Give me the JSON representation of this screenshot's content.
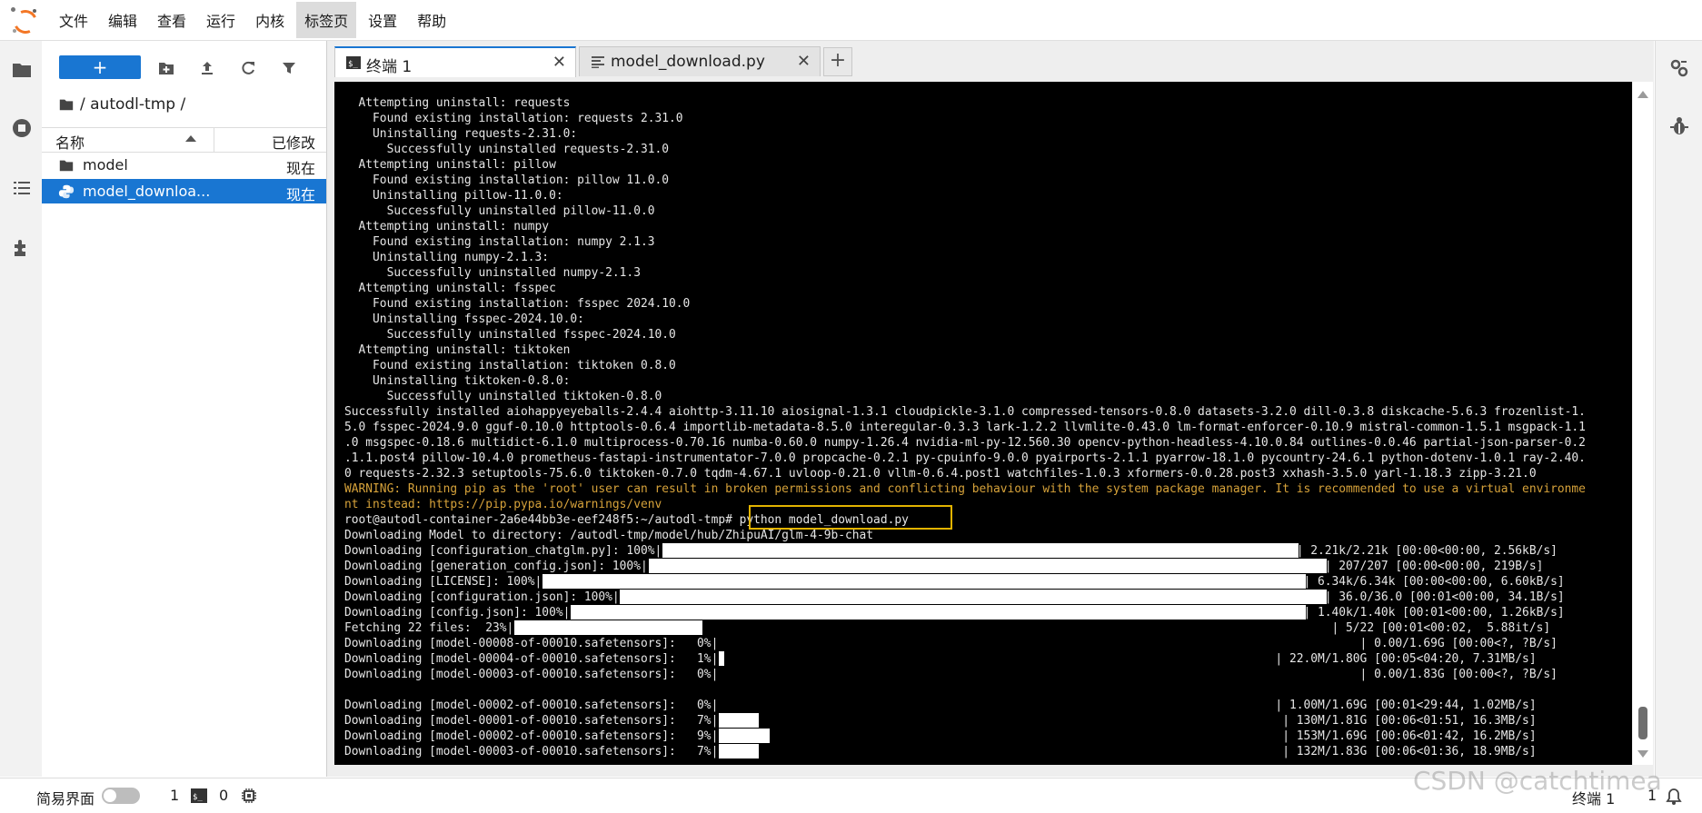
{
  "menu": {
    "items": [
      "文件",
      "编辑",
      "查看",
      "运行",
      "内核",
      "标签页",
      "设置",
      "帮助"
    ],
    "active_index": 5
  },
  "filebrowser": {
    "new_button": "+",
    "breadcrumb": "/ autodl-tmp /",
    "column_name": "名称",
    "column_modified": "已修改",
    "rows": [
      {
        "name": "model",
        "modified": "现在",
        "type": "folder-icon"
      },
      {
        "name": "model_downloa...",
        "modified": "现在",
        "type": "python-file-icon"
      }
    ]
  },
  "tabs": [
    {
      "label": "终端 1",
      "icon": "terminal-icon",
      "close": "✕"
    },
    {
      "label": "model_download.py",
      "icon": "text-file-icon",
      "close": "✕"
    }
  ],
  "tab_add": "+",
  "terminal": {
    "lines": [
      {
        "text": "  Attempting uninstall: requests",
        "warn": false
      },
      {
        "text": "    Found existing installation: requests 2.31.0",
        "warn": false
      },
      {
        "text": "    Uninstalling requests-2.31.0:",
        "warn": false
      },
      {
        "text": "      Successfully uninstalled requests-2.31.0",
        "warn": false
      },
      {
        "text": "  Attempting uninstall: pillow",
        "warn": false
      },
      {
        "text": "    Found existing installation: pillow 11.0.0",
        "warn": false
      },
      {
        "text": "    Uninstalling pillow-11.0.0:",
        "warn": false
      },
      {
        "text": "      Successfully uninstalled pillow-11.0.0",
        "warn": false
      },
      {
        "text": "  Attempting uninstall: numpy",
        "warn": false
      },
      {
        "text": "    Found existing installation: numpy 2.1.3",
        "warn": false
      },
      {
        "text": "    Uninstalling numpy-2.1.3:",
        "warn": false
      },
      {
        "text": "      Successfully uninstalled numpy-2.1.3",
        "warn": false
      },
      {
        "text": "  Attempting uninstall: fsspec",
        "warn": false
      },
      {
        "text": "    Found existing installation: fsspec 2024.10.0",
        "warn": false
      },
      {
        "text": "    Uninstalling fsspec-2024.10.0:",
        "warn": false
      },
      {
        "text": "      Successfully uninstalled fsspec-2024.10.0",
        "warn": false
      },
      {
        "text": "  Attempting uninstall: tiktoken",
        "warn": false
      },
      {
        "text": "    Found existing installation: tiktoken 0.8.0",
        "warn": false
      },
      {
        "text": "    Uninstalling tiktoken-0.8.0:",
        "warn": false
      },
      {
        "text": "      Successfully uninstalled tiktoken-0.8.0",
        "warn": false
      },
      {
        "text": "Successfully installed aiohappyeyeballs-2.4.4 aiohttp-3.11.10 aiosignal-1.3.1 cloudpickle-3.1.0 compressed-tensors-0.8.0 datasets-3.2.0 dill-0.3.8 diskcache-5.6.3 frozenlist-1.",
        "warn": false
      },
      {
        "text": "5.0 fsspec-2024.9.0 gguf-0.10.0 httptools-0.6.4 importlib-metadata-8.5.0 interegular-0.3.3 lark-1.2.2 llvmlite-0.43.0 lm-format-enforcer-0.10.9 mistral-common-1.5.1 msgpack-1.1",
        "warn": false
      },
      {
        "text": ".0 msgspec-0.18.6 multidict-6.1.0 multiprocess-0.70.16 numba-0.60.0 numpy-1.26.4 nvidia-ml-py-12.560.30 opencv-python-headless-4.10.0.84 outlines-0.0.46 partial-json-parser-0.2",
        "warn": false
      },
      {
        "text": ".1.1.post4 pillow-10.4.0 prometheus-fastapi-instrumentator-7.0.0 propcache-0.2.1 py-cpuinfo-9.0.0 pyairports-2.1.1 pyarrow-18.1.0 pycountry-24.6.1 python-dotenv-1.0.1 ray-2.40.",
        "warn": false
      },
      {
        "text": "0 requests-2.32.3 setuptools-75.6.0 tiktoken-0.7.0 tqdm-4.67.1 uvloop-0.21.0 vllm-0.6.4.post1 watchfiles-1.0.3 xformers-0.0.28.post3 xxhash-3.5.0 yarl-1.18.3 zipp-3.21.0",
        "warn": false
      },
      {
        "text": "WARNING: Running pip as the 'root' user can result in broken permissions and conflicting behaviour with the system package manager. It is recommended to use a virtual environme",
        "warn": true
      },
      {
        "text": "nt instead: https://pip.pypa.io/warnings/venv",
        "warn": true
      },
      {
        "text": "root@autodl-container-2a6e44bb3e-eef248f5:~/autodl-tmp# python model_download.py",
        "warn": false
      },
      {
        "text": "Downloading Model to directory: /autodl-tmp/model/hub/ZhipuAI/glm-4-9b-chat",
        "warn": false
      },
      {
        "text": "Downloading [configuration_chatglm.py]: 100%|                                                                                          | 2.21k/2.21k [00:00<00:00, 2.56kB/s]",
        "warn": false
      },
      {
        "text": "Downloading [generation_config.json]: 100%|                                                                                                | 207/207 [00:00<00:00, 219B/s]",
        "warn": false
      },
      {
        "text": "Downloading [LICENSE]: 100%|                                                                                                            | 6.34k/6.34k [00:00<00:00, 6.60kB/s]",
        "warn": false
      },
      {
        "text": "Downloading [configuration.json]: 100%|                                                                                                    | 36.0/36.0 [00:01<00:00, 34.1B/s]",
        "warn": false
      },
      {
        "text": "Downloading [config.json]: 100%|                                                                                                        | 1.40k/1.40k [00:01<00:00, 1.26kB/s]",
        "warn": false
      },
      {
        "text": "Fetching 22 files:  23%|                                                                                                                    | 5/22 [00:01<00:02,  5.88it/s]",
        "warn": false
      },
      {
        "text": "Downloading [model-00008-of-00010.safetensors]:   0%|                                                                                           | 0.00/1.69G [00:00<?, ?B/s]",
        "warn": false
      },
      {
        "text": "Downloading [model-00004-of-00010.safetensors]:   1%|                                                                               | 22.0M/1.80G [00:05<04:20, 7.31MB/s]",
        "warn": false
      },
      {
        "text": "Downloading [model-00003-of-00010.safetensors]:   0%|                                                                                           | 0.00/1.83G [00:00<?, ?B/s]",
        "warn": false
      },
      {
        "text": "",
        "warn": false
      },
      {
        "text": "Downloading [model-00002-of-00010.safetensors]:   0%|                                                                               | 1.00M/1.69G [00:01<29:44, 1.02MB/s]",
        "warn": false
      },
      {
        "text": "Downloading [model-00001-of-00010.safetensors]:   7%|                                                                                | 130M/1.81G [00:06<01:51, 16.3MB/s]",
        "warn": false
      },
      {
        "text": "Downloading [model-00002-of-00010.safetensors]:   9%|                                                                                | 153M/1.69G [00:06<01:42, 16.2MB/s]",
        "warn": false
      },
      {
        "text": "Downloading [model-00003-of-00010.safetensors]:   7%|                                                                                | 132M/1.83G [00:06<01:36, 18.9MB/s]",
        "warn": false
      }
    ],
    "progress": [
      {
        "line": 29,
        "fraction": 1.0
      },
      {
        "line": 30,
        "fraction": 1.0
      },
      {
        "line": 31,
        "fraction": 1.0
      },
      {
        "line": 32,
        "fraction": 1.0
      },
      {
        "line": 33,
        "fraction": 1.0
      },
      {
        "line": 34,
        "fraction": 0.23
      },
      {
        "line": 36,
        "fraction": 0.01
      },
      {
        "line": 40,
        "fraction": 0.07
      },
      {
        "line": 41,
        "fraction": 0.09
      },
      {
        "line": 42,
        "fraction": 0.07
      }
    ]
  },
  "statusbar": {
    "simple_mode": "简易界面",
    "terminal_count": "1",
    "kernel_count": "0",
    "right_text": "终端 1",
    "right_count": "1"
  },
  "watermark": "CSDN @catchtimea",
  "colors": {
    "accent": "#1976d2",
    "warning_text": "#d6a23a",
    "highlight_box": "#e2b300",
    "logo": "#f37726"
  }
}
